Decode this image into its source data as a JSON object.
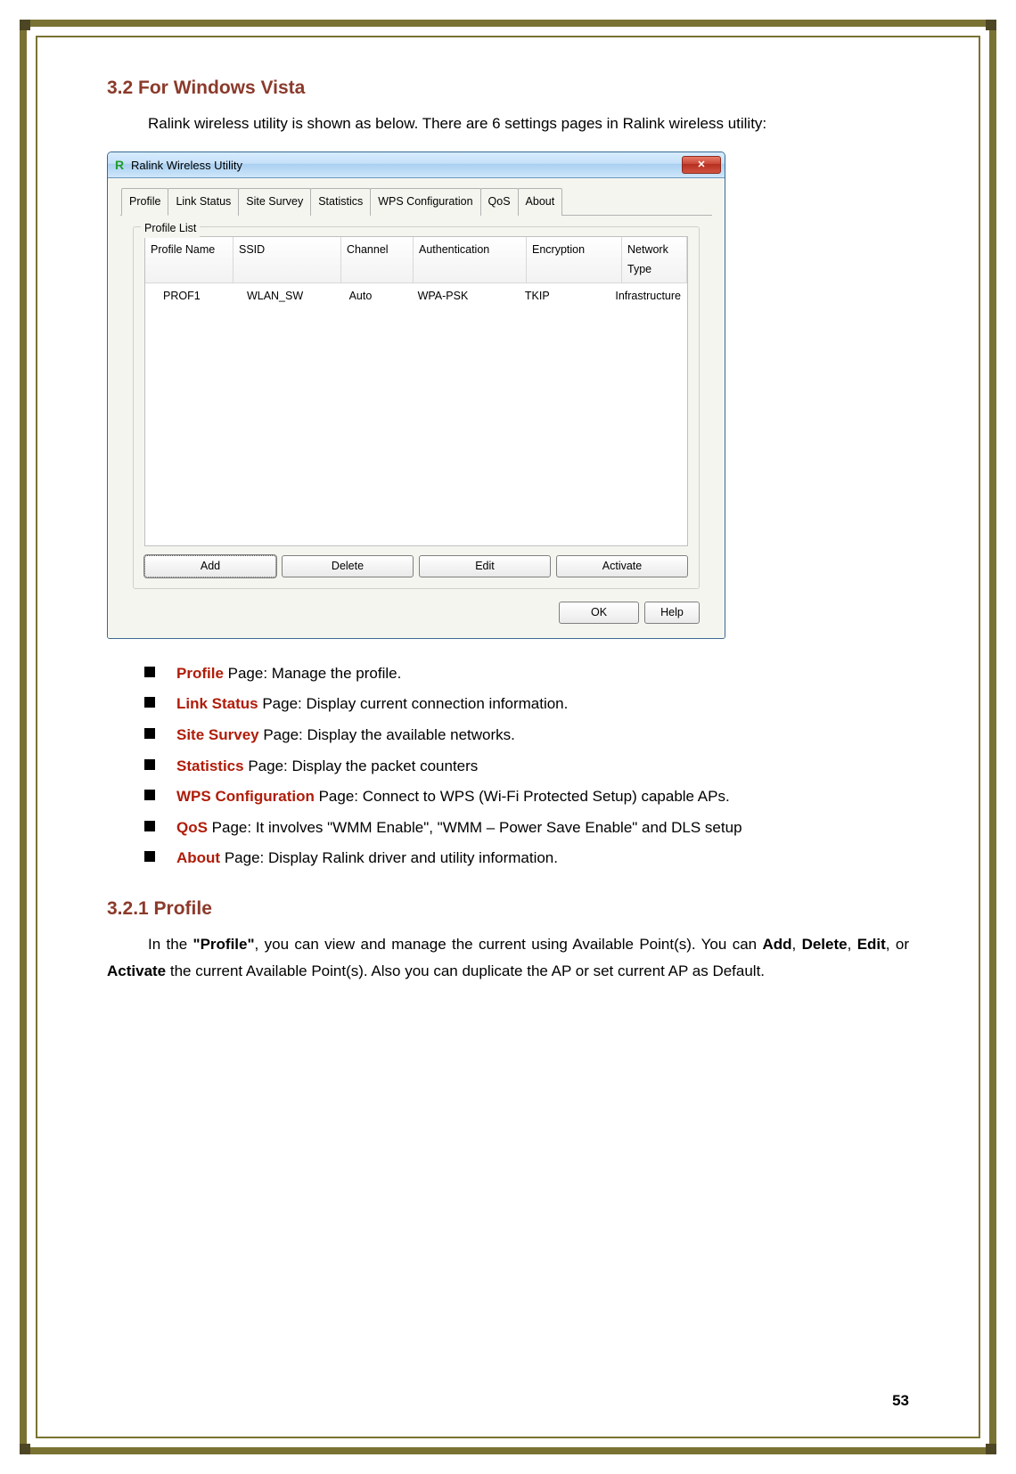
{
  "heading_section": "3.2 For Windows Vista",
  "intro": "Ralink wireless utility is shown as below. There are 6 settings pages in Ralink wireless utility:",
  "window": {
    "title": "Ralink Wireless Utility",
    "close_glyph": "✕",
    "tabs": [
      "Profile",
      "Link Status",
      "Site Survey",
      "Statistics",
      "WPS Configuration",
      "QoS",
      "About"
    ],
    "active_tab": "Profile",
    "groupbox_label": "Profile List",
    "columns": [
      "Profile Name",
      "SSID",
      "Channel",
      "Authentication",
      "Encryption",
      "Network Type"
    ],
    "row": {
      "profile_name": "PROF1",
      "ssid": "WLAN_SW",
      "channel": "Auto",
      "authentication": "WPA-PSK",
      "encryption": "TKIP",
      "network_type": "Infrastructure"
    },
    "buttons": [
      "Add",
      "Delete",
      "Edit",
      "Activate"
    ],
    "ok": "OK",
    "help": "Help"
  },
  "page_bullets": [
    {
      "name": "Profile",
      "desc": " Page: Manage the profile."
    },
    {
      "name": "Link Status",
      "desc": " Page: Display current connection information."
    },
    {
      "name": "Site Survey",
      "desc": " Page: Display the available networks."
    },
    {
      "name": "Statistics",
      "desc": " Page: Display the packet counters"
    },
    {
      "name": "WPS Configuration",
      "desc": " Page: Connect to WPS (Wi-Fi Protected Setup) capable APs."
    },
    {
      "name": "QoS",
      "desc": " Page: It involves \"WMM Enable\", \"WMM – Power Save Enable\" and DLS setup"
    },
    {
      "name": "About",
      "desc": " Page: Display Ralink driver and utility information."
    }
  ],
  "subsection_heading": "3.2.1   Profile",
  "profile_para_prefix": "In the ",
  "profile_para_bold1": "\"Profile\"",
  "profile_para_middle": ", you can view and manage the current using Available Point(s). You can ",
  "btn_add": "Add",
  "btn_del": "Delete",
  "btn_edit": "Edit",
  "btn_act": "Activate",
  "profile_para_suffix": " the current Available Point(s). Also you can duplicate the AP or set current AP as Default.",
  "sep": ", ",
  "or": ", or ",
  "page_number": "53"
}
